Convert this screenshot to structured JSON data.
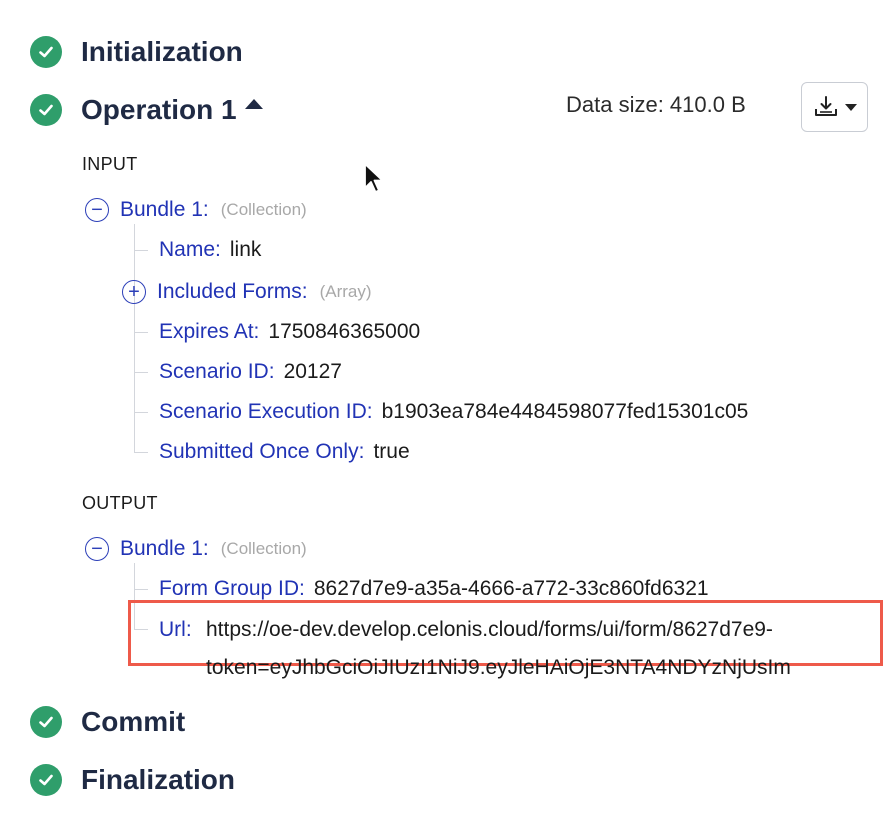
{
  "phases": {
    "initialization": "Initialization",
    "operation": "Operation 1",
    "commit": "Commit",
    "finalization": "Finalization"
  },
  "toolbar": {
    "data_size": "Data size: 410.0 B"
  },
  "input": {
    "label": "INPUT",
    "bundle": {
      "key": "Bundle 1:",
      "type": "(Collection)"
    },
    "fields": [
      {
        "key": "Name:",
        "value": "link"
      },
      {
        "key": "Included Forms:",
        "type": "(Array)"
      },
      {
        "key": "Expires At:",
        "value": "1750846365000"
      },
      {
        "key": "Scenario ID:",
        "value": "20127"
      },
      {
        "key": "Scenario Execution ID:",
        "value": "b1903ea784e4484598077fed15301c05"
      },
      {
        "key": "Submitted Once Only:",
        "value": "true"
      }
    ]
  },
  "output": {
    "label": "OUTPUT",
    "bundle": {
      "key": "Bundle 1:",
      "type": "(Collection)"
    },
    "fields": [
      {
        "key": "Form Group ID:",
        "value": "8627d7e9-a35a-4666-a772-33c860fd6321"
      },
      {
        "key": "Url:",
        "value_line1": "https://oe-dev.develop.celonis.cloud/forms/ui/form/8627d7e9-",
        "value_line2": "token=eyJhbGciOiJIUzI1NiJ9.eyJleHAiOjE3NTA4NDYzNjUsIm"
      }
    ]
  },
  "icons": {
    "phase_status": "check-circle-icon",
    "download": "download-icon",
    "collapse": "minus-circle-icon",
    "expand": "plus-circle-icon",
    "pointer": "mouse-pointer-icon"
  },
  "colors": {
    "success": "#2f9e6b",
    "key_text": "#2133b5",
    "highlight_border": "#ee5a4a"
  }
}
